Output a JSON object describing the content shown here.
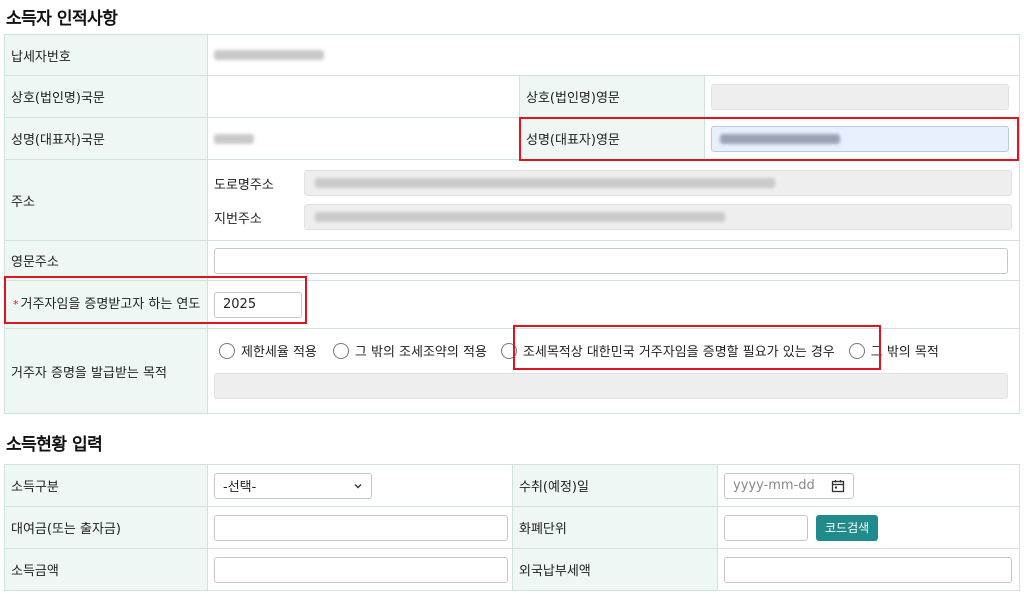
{
  "section1": {
    "title": "소득자 인적사항",
    "taxpayer_no_label": "납세자번호",
    "company_kr_label": "상호(법인명)국문",
    "company_en_label": "상호(법인명)영문",
    "name_kr_label": "성명(대표자)국문",
    "name_en_label": "성명(대표자)영문",
    "address_label": "주소",
    "road_address_label": "도로명주소",
    "lot_address_label": "지번주소",
    "en_address_label": "영문주소",
    "year_label": "거주자임을 증명받고자 하는 연도",
    "required_mark": "*",
    "year_value": "2025",
    "purpose_label": "거주자 증명을 발급받는 목적",
    "purpose_options": [
      "제한세율 적용",
      "그 밖의 조세조약의 적용",
      "조세목적상 대한민국 거주자임을 증명할 필요가 있는 경우",
      "그 밖의 목적"
    ]
  },
  "section2": {
    "title": "소득현황 입력",
    "income_type_label": "소득구분",
    "income_type_value": "-선택-",
    "receipt_date_label": "수취(예정)일",
    "receipt_date_placeholder": "yyyy-mm-dd",
    "loan_label": "대여금(또는 출자금)",
    "currency_label": "화폐단위",
    "code_search_button": "코드검색",
    "income_amount_label": "소득금액",
    "foreign_tax_label": "외국납부세액"
  },
  "colors": {
    "highlight": "#e0141e",
    "label_bg": "#eef7f4",
    "border": "#cfe3dd",
    "button": "#1f8b8b"
  }
}
